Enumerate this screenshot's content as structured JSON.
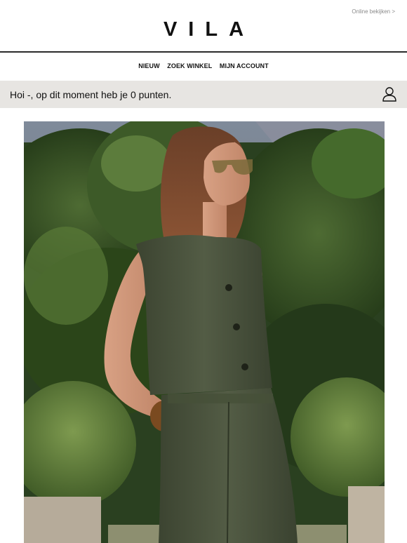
{
  "header": {
    "view_online": "Online bekijken >",
    "logo_text": "VILA"
  },
  "nav": {
    "items": [
      "NIEUW",
      "ZOEK WINKEL",
      "MIJN ACCOUNT"
    ]
  },
  "points": {
    "message": "Hoi -, op dit moment heb je 0 punten.",
    "icon": "user-icon"
  },
  "hero": {
    "description_icon": "hero-photo"
  },
  "colors": {
    "points_bar": "#e7e5e2",
    "divider": "#2a2a2a",
    "outfit": "#4b5440"
  }
}
